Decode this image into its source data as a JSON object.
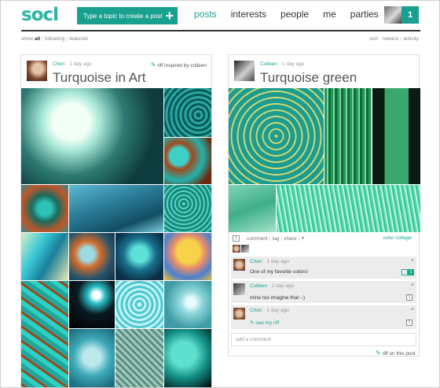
{
  "header": {
    "logo": "socl",
    "create_button_label": "Type a topic to create a post",
    "create_button_icon": "+",
    "nav": [
      "posts",
      "interests",
      "people",
      "me",
      "parties"
    ],
    "active_nav": "posts",
    "notification_count": "1"
  },
  "filters": {
    "show_label": "show",
    "show_options": [
      "all",
      "following",
      "featured"
    ],
    "sort_label": "sort",
    "sort_options": [
      "newest",
      "activity"
    ]
  },
  "post_left": {
    "author": "Cheri",
    "time": "1 day ago",
    "riff_text": "riff inspired by colleen",
    "title": "Turquoise in Art"
  },
  "post_right": {
    "author": "Colleen",
    "time": "1 day ago",
    "title": "Turquoise green",
    "actions": [
      "comment",
      "tag",
      "share"
    ],
    "action_count": "1",
    "dropdown_glyph": "▼",
    "collage_label": "color collage",
    "comments": [
      {
        "author": "Cheri",
        "time": "1 day ago",
        "text": "One of my favorite colors!",
        "count": "1",
        "box": "1"
      },
      {
        "author": "Colleen",
        "time": "1 day ago",
        "text": "mine too imagine that :-)",
        "box": "1"
      },
      {
        "author": "Cheri",
        "time": "1 day ago",
        "text": "see my riff",
        "box": "1"
      }
    ],
    "close_glyph": "×",
    "add_comment_placeholder": "add a comment",
    "riff_on_post": "riff on this post"
  },
  "colors": {
    "accent": "#19a08f",
    "accent_text": "#1ea592"
  },
  "icons": {
    "riff": "riff-icon",
    "create": "plus-icon"
  }
}
